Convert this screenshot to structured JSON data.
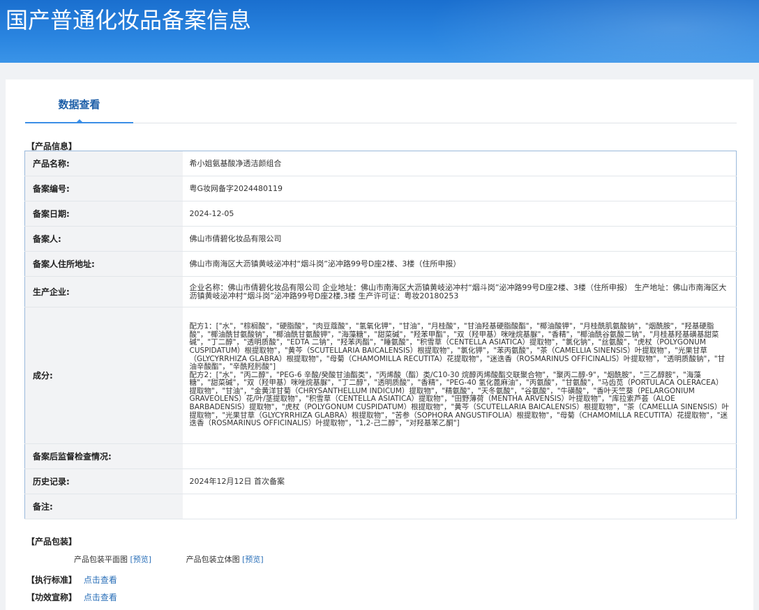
{
  "header": {
    "title": "国产普通化妆品备案信息"
  },
  "tabs": [
    {
      "label": "数据查看"
    }
  ],
  "product_section": {
    "title": "【产品信息】",
    "rows": [
      {
        "label": "产品名称:",
        "value": "希小姐氨基酸净透洁颜组合"
      },
      {
        "label": "备案编号:",
        "value": "粤G妆网备字2024480119"
      },
      {
        "label": "备案日期:",
        "value": "2024-12-05"
      },
      {
        "label": "备案人:",
        "value": "佛山市倩碧化妆品有限公司"
      },
      {
        "label": "备案人住所地址:",
        "value": "佛山市南海区大沥镇黄岐泌冲村“烟斗岗”泌冲路99号D座2楼、3楼（住所申报）"
      },
      {
        "label": "生产企业:",
        "value": "企业名称：佛山市倩碧化妆品有限公司 企业地址：佛山市南海区大沥镇黄岐泌冲村“烟斗岗”泌冲路99号D座2楼、3楼（住所申报） 生产地址：佛山市南海区大沥镇黄岐泌冲村“烟斗岗”泌冲路99号D座2楼,3楼 生产许可证：粤妆20180253"
      },
      {
        "label": "成分:",
        "value": "配方1：[\"水\"，\"棕榈酸\"，\"硬脂酸\"，\"肉豆蔻酸\"，\"氢氧化钾\"，\"甘油\"，\"月桂酸\"，\"甘油羟基硬脂酸酯\"，\"椰油酸钾\"，\"月桂酰肌氨酸钠\"，\"烟酰胺\"，\"羟基硬脂酸\"，\"椰油酰甘氨酸钠\"，\"椰油酰甘氨酸钾\"，\"海藻糖\"，\"甜菜碱\"，\"羟苯甲酯\"，\"双（羟甲基）咪唑烷基脲\"，\"香精\"，\"椰油酰谷氨酸二钠\"，\"月桂基羟基磺基甜菜碱\"，\"丁二醇\"，\"透明质酸\"，\"EDTA 二钠\"，\"羟苯丙酯\"，\"睡氨酸\"，\"积雪草（CENTELLA ASIATICA）提取物\"，\"氯化钠\"，\"丝氨酸\"，\"虎杖（POLYGONUM CUSPIDATUM）根提取物\"，\"黄芩（SCUTELLARIA BAICALENSIS）根提取物\"，\"氯化钾\"，\"苯丙氨酸\"，\"茶（CAMELLIA SINENSIS）叶提取物\"，\"光果甘草（GLYCYRRHIZA GLABRA）根提取物\"，\"母菊（CHAMOMILLA RECUTITA）花提取物\"，\"迷迭香（ROSMARINUS OFFICINALIS）叶提取物\"，\"透明质酸钠\"，\"甘油辛酸酯\"，\"辛酰羟肟酸\"]\n配方2：[\"水\"，\"丙二醇\"，\"PEG-6 辛酸/癸酸甘油酯类\"，\"丙烯酸（酯）类/C10-30 烷醇丙烯酸酯交联聚合物\"，\"聚丙二醇-9\"，\"烟酰胺\"，\"三乙醇胺\"，\"海藻糖\"，\"甜菜碱\"，\"双（羟甲基）咪唑烷基脲\"，\"丁二醇\"，\"透明质酸\"，\"香精\"，\"PEG-40 氢化蓖麻油\"，\"丙氨酸\"，\"甘氨酸\"，\"马齿苋（PORTULACA OLERACEA）提取物\"，\"甘油\"，\"金黄洋甘菊（CHRYSANTHELLUM INDICUM）提取物\"，\"精氨酸\"，\"天冬氨酸\"，\"谷氨酸\"，\"牛磺酸\"，\"香叶天竺葵（PELARGONIUM GRAVEOLENS）花/叶/茎提取物\"，\"积雪草（CENTELLA ASIATICA）提取物\"，\"田野薄荷（MENTHA ARVENSIS）叶提取物\"，\"库拉索芦荟（ALOE BARBADENSIS）提取物\"，\"虎杖（POLYGONUM CUSPIDATUM）根提取物\"，\"黄芩（SCUTELLARIA BAICALENSIS）根提取物\"，\"茶（CAMELLIA SINENSIS）叶提取物\"，\"光果甘草（GLYCYRRHIZA GLABRA）根提取物\"，\"苦参（SOPHORA ANGUSTIFOLIA）根提取物\"，\"母菊（CHAMOMILLA RECUTITA）花提取物\"，\"迷迭香（ROSMARINUS OFFICINALIS）叶提取物\"，\"1,2-己二醇\"，\"对羟基苯乙酮\"]"
      },
      {
        "label": "备案后监督检查情况:",
        "value": ""
      },
      {
        "label": "历史记录:",
        "value": "2024年12月12日 首次备案"
      },
      {
        "label": "备注:",
        "value": ""
      }
    ]
  },
  "packaging": {
    "title": "【产品包装】",
    "flat_label": "产品包装平面图",
    "flat_link": "[预览]",
    "solid_label": "产品包装立体图",
    "solid_link": "[预览]"
  },
  "standard": {
    "label": "【执行标准】",
    "link": "点击查看"
  },
  "efficacy": {
    "label": "【功效宣称】",
    "link": "点击查看"
  }
}
